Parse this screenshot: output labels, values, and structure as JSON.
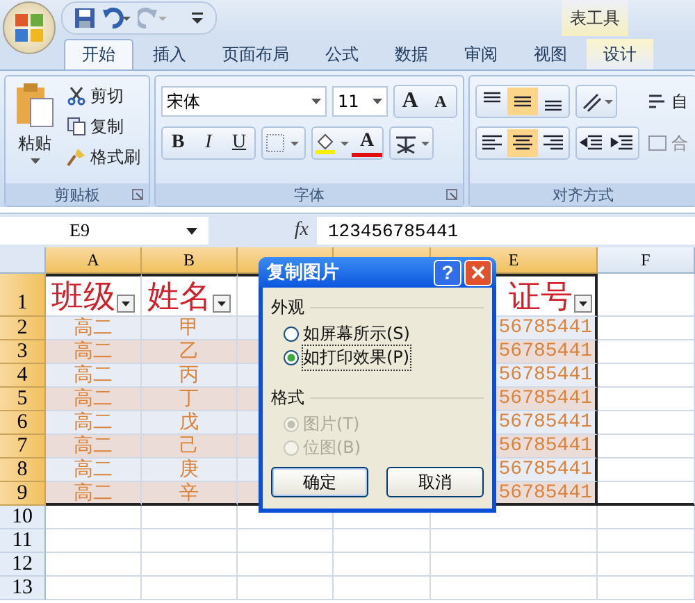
{
  "contextual_tab_group": "表工具",
  "tabs": [
    {
      "label": "开始",
      "selected": true,
      "kind": "normal"
    },
    {
      "label": "插入",
      "selected": false,
      "kind": "normal"
    },
    {
      "label": "页面布局",
      "selected": false,
      "kind": "normal"
    },
    {
      "label": "公式",
      "selected": false,
      "kind": "normal"
    },
    {
      "label": "数据",
      "selected": false,
      "kind": "normal"
    },
    {
      "label": "审阅",
      "selected": false,
      "kind": "normal"
    },
    {
      "label": "视图",
      "selected": false,
      "kind": "normal"
    },
    {
      "label": "设计",
      "selected": false,
      "kind": "contextual"
    }
  ],
  "clipboard": {
    "label": "剪贴板",
    "paste": "粘贴",
    "cut": "剪切",
    "copy": "复制",
    "format_painter": "格式刷"
  },
  "font": {
    "label": "字体",
    "font_name": "宋体",
    "font_size": "11",
    "grow": "A",
    "shrink": "A",
    "bold": "B",
    "italic": "I",
    "underline": "U",
    "font_color": "A"
  },
  "alignment": {
    "label": "对齐方式",
    "vertical": [
      {
        "selected": false
      },
      {
        "selected": true
      },
      {
        "selected": false
      }
    ],
    "horizontal": [
      {
        "selected": false
      },
      {
        "selected": true
      },
      {
        "selected": false
      }
    ],
    "wrap_text": "自",
    "merge": "合"
  },
  "formula_bar": {
    "name_box": "E9",
    "function_label": "fx",
    "value": "123456785441"
  },
  "columns": [
    {
      "label": "A"
    },
    {
      "label": "B"
    },
    {},
    {},
    {
      "label": "E"
    },
    {
      "label": "F"
    }
  ],
  "row_numbers": [
    "1",
    "2",
    "3",
    "4",
    "5",
    "6",
    "7",
    "8",
    "9",
    "10",
    "11",
    "12",
    "13"
  ],
  "table": {
    "header": [
      {
        "text": "班级",
        "filter": true
      },
      {
        "text": "姓名",
        "filter": true
      },
      {
        "text": "证号",
        "filter": true
      }
    ],
    "rows": [
      [
        "高二",
        "甲",
        "56785441"
      ],
      [
        "高二",
        "乙",
        "56785441"
      ],
      [
        "高二",
        "丙",
        "56785441"
      ],
      [
        "高二",
        "丁",
        "56785441"
      ],
      [
        "高二",
        "戊",
        "56785441"
      ],
      [
        "高二",
        "己",
        "56785441"
      ],
      [
        "高二",
        "庚",
        "56785441"
      ],
      [
        "高二",
        "辛",
        "56785441"
      ]
    ]
  },
  "dialog": {
    "title": "复制图片",
    "help": "?",
    "appearance": {
      "label": "外观",
      "options": [
        {
          "label": "如屏幕所示(S)",
          "selected": false,
          "disabled": false
        },
        {
          "label": "如打印效果(P)",
          "selected": true,
          "disabled": false
        }
      ]
    },
    "format": {
      "label": "格式",
      "options": [
        {
          "label": "图片(T)",
          "selected": true,
          "disabled": true
        },
        {
          "label": "位图(B)",
          "selected": false,
          "disabled": true
        }
      ]
    },
    "buttons": [
      "确定",
      "取消"
    ]
  }
}
